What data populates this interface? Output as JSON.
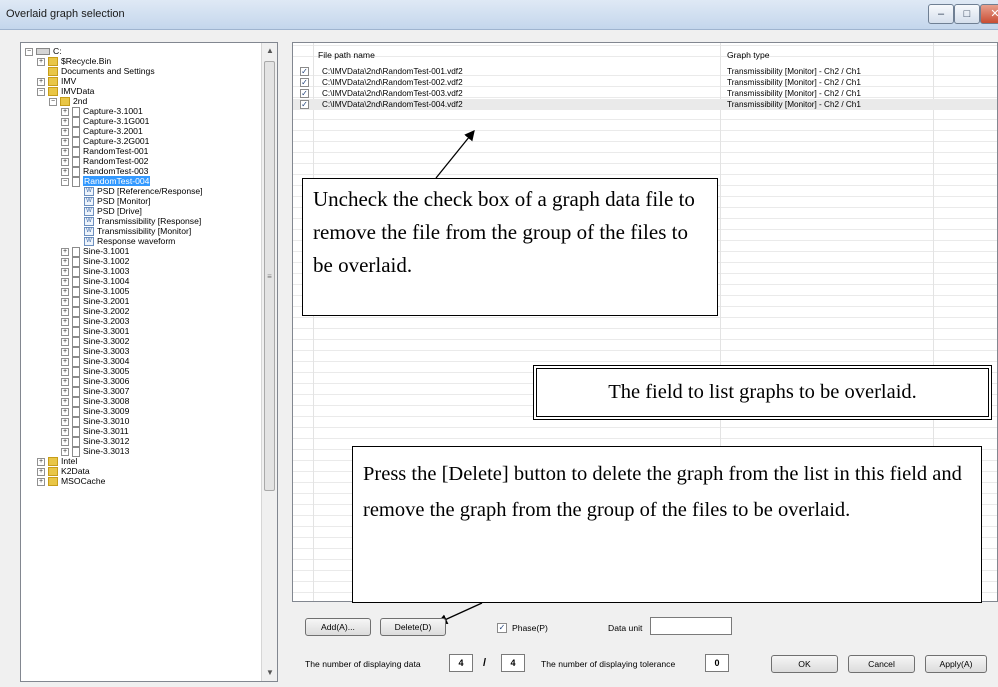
{
  "window": {
    "title": "Overlaid graph selection",
    "min_glyph": "–",
    "max_glyph": "□",
    "close_glyph": "✕"
  },
  "tree": {
    "items": [
      {
        "label": "C:",
        "indent": 0,
        "icon": "drive-icon",
        "exp": "−"
      },
      {
        "label": "$Recycle.Bin",
        "indent": 1,
        "icon": "folder-icon",
        "exp": "+"
      },
      {
        "label": "Documents and Settings",
        "indent": 1,
        "icon": "folder-icon",
        "exp": ""
      },
      {
        "label": "IMV",
        "indent": 1,
        "icon": "folder-icon",
        "exp": "+"
      },
      {
        "label": "IMVData",
        "indent": 1,
        "icon": "folder-icon",
        "exp": "−"
      },
      {
        "label": "2nd",
        "indent": 2,
        "icon": "folder-icon",
        "exp": "−"
      },
      {
        "label": "Capture-3.1001",
        "indent": 3,
        "icon": "file-icon",
        "exp": "+"
      },
      {
        "label": "Capture-3.1G001",
        "indent": 3,
        "icon": "file-icon",
        "exp": "+"
      },
      {
        "label": "Capture-3.2001",
        "indent": 3,
        "icon": "file-icon",
        "exp": "+"
      },
      {
        "label": "Capture-3.2G001",
        "indent": 3,
        "icon": "file-icon",
        "exp": "+"
      },
      {
        "label": "RandomTest-001",
        "indent": 3,
        "icon": "file-icon",
        "exp": "+"
      },
      {
        "label": "RandomTest-002",
        "indent": 3,
        "icon": "file-icon",
        "exp": "+"
      },
      {
        "label": "RandomTest-003",
        "indent": 3,
        "icon": "file-icon",
        "exp": "+"
      },
      {
        "label": "RandomTest-004",
        "indent": 3,
        "icon": "file-icon",
        "exp": "−",
        "selected": true
      },
      {
        "label": "PSD [Reference/Response]",
        "indent": 4,
        "icon": "graph-icon",
        "exp": ""
      },
      {
        "label": "PSD [Monitor]",
        "indent": 4,
        "icon": "graph-icon",
        "exp": ""
      },
      {
        "label": "PSD [Drive]",
        "indent": 4,
        "icon": "graph-icon",
        "exp": ""
      },
      {
        "label": "Transmissibility [Response]",
        "indent": 4,
        "icon": "graph-icon",
        "exp": ""
      },
      {
        "label": "Transmissibility [Monitor]",
        "indent": 4,
        "icon": "graph-icon",
        "exp": ""
      },
      {
        "label": "Response waveform",
        "indent": 4,
        "icon": "graph-icon",
        "exp": ""
      },
      {
        "label": "Sine-3.1001",
        "indent": 3,
        "icon": "file-icon",
        "exp": "+"
      },
      {
        "label": "Sine-3.1002",
        "indent": 3,
        "icon": "file-icon",
        "exp": "+"
      },
      {
        "label": "Sine-3.1003",
        "indent": 3,
        "icon": "file-icon",
        "exp": "+"
      },
      {
        "label": "Sine-3.1004",
        "indent": 3,
        "icon": "file-icon",
        "exp": "+"
      },
      {
        "label": "Sine-3.1005",
        "indent": 3,
        "icon": "file-icon",
        "exp": "+"
      },
      {
        "label": "Sine-3.2001",
        "indent": 3,
        "icon": "file-icon",
        "exp": "+"
      },
      {
        "label": "Sine-3.2002",
        "indent": 3,
        "icon": "file-icon",
        "exp": "+"
      },
      {
        "label": "Sine-3.2003",
        "indent": 3,
        "icon": "file-icon",
        "exp": "+"
      },
      {
        "label": "Sine-3.3001",
        "indent": 3,
        "icon": "file-icon",
        "exp": "+"
      },
      {
        "label": "Sine-3.3002",
        "indent": 3,
        "icon": "file-icon",
        "exp": "+"
      },
      {
        "label": "Sine-3.3003",
        "indent": 3,
        "icon": "file-icon",
        "exp": "+"
      },
      {
        "label": "Sine-3.3004",
        "indent": 3,
        "icon": "file-icon",
        "exp": "+"
      },
      {
        "label": "Sine-3.3005",
        "indent": 3,
        "icon": "file-icon",
        "exp": "+"
      },
      {
        "label": "Sine-3.3006",
        "indent": 3,
        "icon": "file-icon",
        "exp": "+"
      },
      {
        "label": "Sine-3.3007",
        "indent": 3,
        "icon": "file-icon",
        "exp": "+"
      },
      {
        "label": "Sine-3.3008",
        "indent": 3,
        "icon": "file-icon",
        "exp": "+"
      },
      {
        "label": "Sine-3.3009",
        "indent": 3,
        "icon": "file-icon",
        "exp": "+"
      },
      {
        "label": "Sine-3.3010",
        "indent": 3,
        "icon": "file-icon",
        "exp": "+"
      },
      {
        "label": "Sine-3.3011",
        "indent": 3,
        "icon": "file-icon",
        "exp": "+"
      },
      {
        "label": "Sine-3.3012",
        "indent": 3,
        "icon": "file-icon",
        "exp": "+"
      },
      {
        "label": "Sine-3.3013",
        "indent": 3,
        "icon": "file-icon",
        "exp": "+"
      },
      {
        "label": "Intel",
        "indent": 1,
        "icon": "folder-icon",
        "exp": "+"
      },
      {
        "label": "K2Data",
        "indent": 1,
        "icon": "folder-icon",
        "exp": "+"
      },
      {
        "label": "MSOCache",
        "indent": 1,
        "icon": "folder-icon",
        "exp": "+"
      }
    ],
    "scroll_up": "▲",
    "scroll_down": "▼",
    "scroll_grip": "≡"
  },
  "list": {
    "col_file": "File path name",
    "col_type": "Graph type",
    "rows": [
      {
        "checked": true,
        "path": "C:\\IMVData\\2nd\\RandomTest-001.vdf2",
        "type": "Transmissibility [Monitor] - Ch2 / Ch1"
      },
      {
        "checked": true,
        "path": "C:\\IMVData\\2nd\\RandomTest-002.vdf2",
        "type": "Transmissibility [Monitor] - Ch2 / Ch1"
      },
      {
        "checked": true,
        "path": "C:\\IMVData\\2nd\\RandomTest-003.vdf2",
        "type": "Transmissibility [Monitor] - Ch2 / Ch1"
      },
      {
        "checked": true,
        "path": "C:\\IMVData\\2nd\\RandomTest-004.vdf2",
        "type": "Transmissibility [Monitor] - Ch2 / Ch1"
      }
    ],
    "check_glyph": "✓"
  },
  "callouts": {
    "uncheck_text": "Uncheck the check box of a graph data file to remove the file from the group of the files to be overlaid.",
    "field_text": "The field to list graphs to be overlaid.",
    "delete_text": "Press the [Delete] button to delete the graph from the list in this field and remove the graph from the group of the files to be overlaid."
  },
  "controls": {
    "add_label": "Add(A)...",
    "delete_label": "Delete(D)",
    "phase_label": "Phase(P)",
    "phase_checked": true,
    "data_unit_label": "Data unit",
    "data_unit_value": "",
    "displaying_data_label": "The number of displaying data",
    "displaying_count": "4",
    "slash": "/",
    "total_count": "4",
    "tolerance_label": "The number of displaying tolerance",
    "tolerance_value": "0",
    "ok_label": "OK",
    "cancel_label": "Cancel",
    "apply_label": "Apply(A)"
  }
}
